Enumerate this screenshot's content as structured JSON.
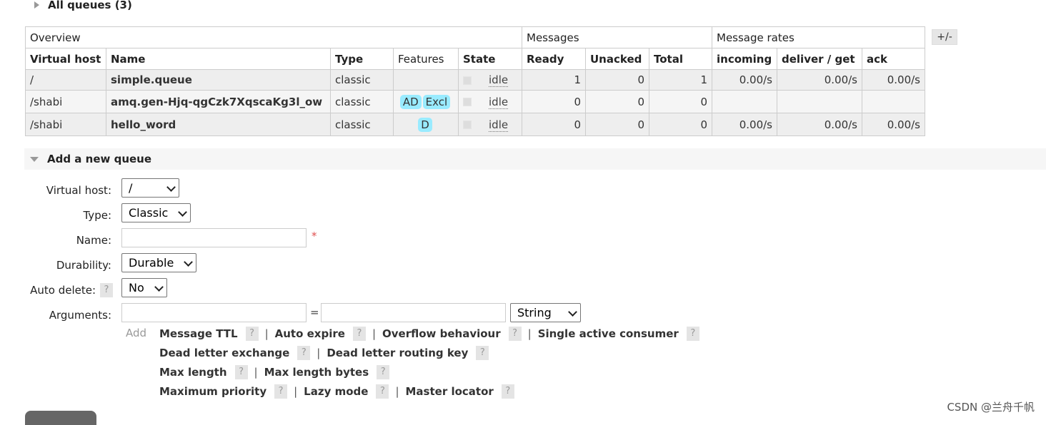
{
  "all_queues": {
    "label": "All queues (3)"
  },
  "table": {
    "groups": {
      "overview": "Overview",
      "messages": "Messages",
      "message_rates": "Message rates"
    },
    "columns": {
      "virtual_host": "Virtual host",
      "name": "Name",
      "type": "Type",
      "features": "Features",
      "state": "State",
      "ready": "Ready",
      "unacked": "Unacked",
      "total": "Total",
      "incoming": "incoming",
      "deliver_get": "deliver / get",
      "ack": "ack"
    },
    "plus_minus": "+/-",
    "rows": [
      {
        "vhost": "/",
        "name": "simple.queue",
        "type": "classic",
        "features": [],
        "state": "idle",
        "ready": "1",
        "unacked": "0",
        "total": "1",
        "incoming": "0.00/s",
        "deliver_get": "0.00/s",
        "ack": "0.00/s"
      },
      {
        "vhost": "/shabi",
        "name": "amq.gen-Hjq-qgCzk7XqscaKg3l_ow",
        "type": "classic",
        "features": [
          "AD",
          "Excl"
        ],
        "state": "idle",
        "ready": "0",
        "unacked": "0",
        "total": "0",
        "incoming": "",
        "deliver_get": "",
        "ack": ""
      },
      {
        "vhost": "/shabi",
        "name": "hello_word",
        "type": "classic",
        "features": [
          "D"
        ],
        "state": "idle",
        "ready": "0",
        "unacked": "0",
        "total": "0",
        "incoming": "0.00/s",
        "deliver_get": "0.00/s",
        "ack": "0.00/s"
      }
    ]
  },
  "add_queue": {
    "title": "Add a new queue",
    "labels": {
      "virtual_host": "Virtual host:",
      "type": "Type:",
      "name": "Name:",
      "durability": "Durability:",
      "auto_delete": "Auto delete:",
      "arguments": "Arguments:"
    },
    "values": {
      "virtual_host": "/",
      "type": "Classic",
      "durability": "Durable",
      "auto_delete": "No",
      "arg_type": "String"
    },
    "required_mark": "*",
    "help_mark": "?",
    "equals": "=",
    "add_label": "Add",
    "separator": "|",
    "arg_links": {
      "message_ttl": "Message TTL",
      "auto_expire": "Auto expire",
      "overflow_behaviour": "Overflow behaviour",
      "single_active_consumer": "Single active consumer",
      "dead_letter_exchange": "Dead letter exchange",
      "dead_letter_routing_key": "Dead letter routing key",
      "max_length": "Max length",
      "max_length_bytes": "Max length bytes",
      "maximum_priority": "Maximum priority",
      "lazy_mode": "Lazy mode",
      "master_locator": "Master locator"
    }
  },
  "watermark": "CSDN @兰舟千帆"
}
